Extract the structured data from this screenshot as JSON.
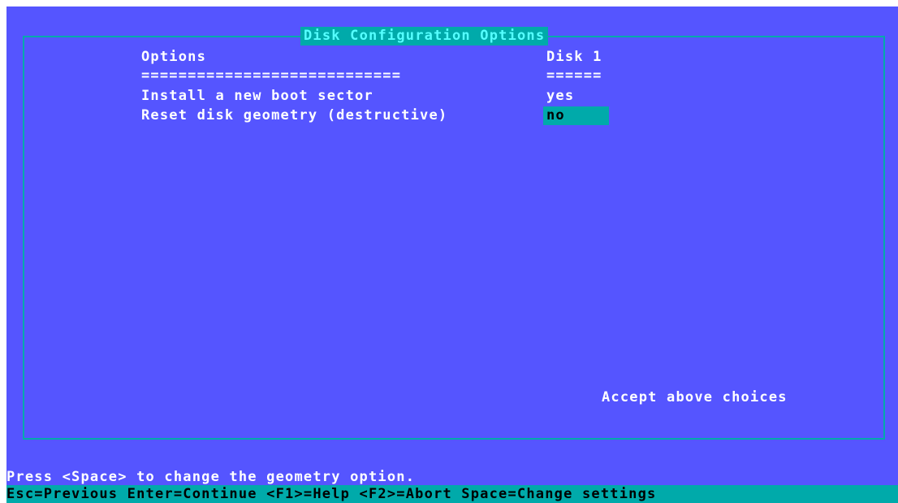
{
  "dialog": {
    "title": "Disk Configuration Options",
    "options_header": "Options",
    "disk_header": "Disk 1",
    "options_separator": "============================",
    "disk_separator": "======",
    "rows": [
      {
        "label": "Install a new boot sector",
        "value": "yes"
      },
      {
        "label": "Reset disk geometry (destructive)",
        "value": "no"
      }
    ],
    "accept_label": "Accept above choices"
  },
  "prompt": "Press <Space> to change the geometry option.",
  "statusbar": "Esc=Previous Enter=Continue <F1>=Help <F2>=Abort Space=Change settings",
  "colors": {
    "background": "#5555ff",
    "frame": "#00aaaa",
    "highlight": "#00aaaa",
    "title_text": "#55ffff",
    "text": "#ffffff"
  }
}
